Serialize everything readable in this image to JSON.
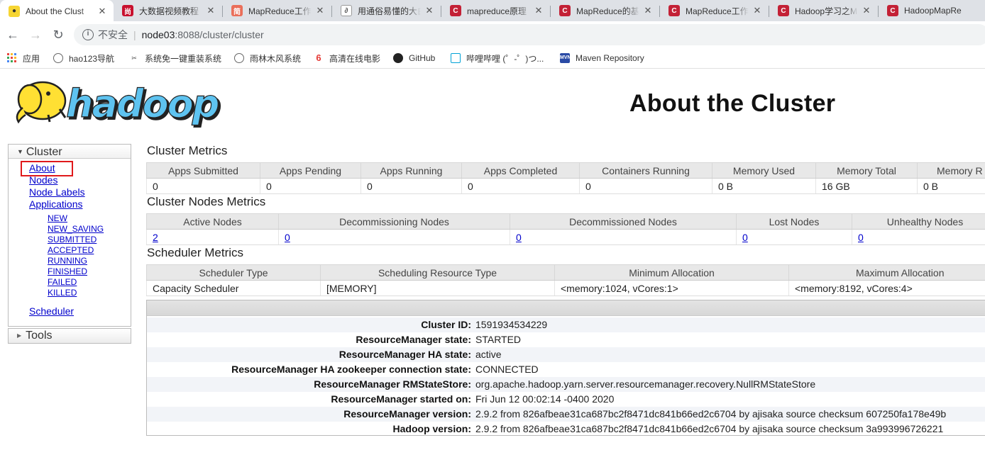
{
  "browser": {
    "tabs": [
      {
        "title": "About the Clust",
        "icon": "hadoop-favicon",
        "color": "#f6d533",
        "active": true
      },
      {
        "title": "大数据视频教程",
        "icon": "shang-favicon",
        "color": "#c8102e"
      },
      {
        "title": "MapReduce工作",
        "icon": "jian-favicon",
        "color": "#ea6f5a"
      },
      {
        "title": "用通俗易懂的大白",
        "icon": "zhihu-like-favicon",
        "color": "#555555"
      },
      {
        "title": "mapreduce原理",
        "icon": "csdn-favicon",
        "color": "#c32136"
      },
      {
        "title": "MapReduce的基",
        "icon": "csdn-favicon",
        "color": "#c32136"
      },
      {
        "title": "MapReduce工作",
        "icon": "csdn-favicon",
        "color": "#c32136"
      },
      {
        "title": "Hadoop学习之M",
        "icon": "csdn-favicon",
        "color": "#c32136"
      },
      {
        "title": "HadoopMapRe",
        "icon": "csdn-favicon",
        "color": "#c32136"
      }
    ],
    "address": {
      "security_label": "不安全",
      "host": "node03",
      "path": ":8088/cluster/cluster"
    },
    "bookmarks": [
      {
        "label": "应用",
        "icon": "apps-grid-icon"
      },
      {
        "label": "hao123导航",
        "icon": "globe-icon"
      },
      {
        "label": "系统免一键重装系统",
        "icon": "tool-icon"
      },
      {
        "label": "雨林木风系统",
        "icon": "globe-icon"
      },
      {
        "label": "高清在线电影",
        "icon": "flame-icon"
      },
      {
        "label": "GitHub",
        "icon": "github-icon"
      },
      {
        "label": "哔哩哔哩 (゜-゜)つ...",
        "icon": "bilibili-icon"
      },
      {
        "label": "Maven Repository",
        "icon": "maven-icon"
      }
    ]
  },
  "page": {
    "title": "About the Cluster",
    "logo_text": "hadoop"
  },
  "sidebar": {
    "cluster_header": "Cluster",
    "links": {
      "about": "About",
      "nodes": "Nodes",
      "node_labels": "Node Labels",
      "applications": "Applications",
      "scheduler": "Scheduler"
    },
    "app_states": [
      "NEW",
      "NEW_SAVING",
      "SUBMITTED",
      "ACCEPTED",
      "RUNNING",
      "FINISHED",
      "FAILED",
      "KILLED"
    ],
    "tools_header": "Tools"
  },
  "cluster_metrics": {
    "title": "Cluster Metrics",
    "headers": [
      "Apps Submitted",
      "Apps Pending",
      "Apps Running",
      "Apps Completed",
      "Containers Running",
      "Memory Used",
      "Memory Total",
      "Memory R"
    ],
    "values": [
      "0",
      "0",
      "0",
      "0",
      "0",
      "0 B",
      "16 GB",
      "0 B"
    ]
  },
  "node_metrics": {
    "title": "Cluster Nodes Metrics",
    "headers": [
      "Active Nodes",
      "Decommissioning Nodes",
      "Decommissioned Nodes",
      "Lost Nodes",
      "Unhealthy Nodes"
    ],
    "values": [
      "2",
      "0",
      "0",
      "0",
      "0"
    ]
  },
  "scheduler_metrics": {
    "title": "Scheduler Metrics",
    "headers": [
      "Scheduler Type",
      "Scheduling Resource Type",
      "Minimum Allocation",
      "Maximum Allocation"
    ],
    "values": [
      "Capacity Scheduler",
      "[MEMORY]",
      "<memory:1024, vCores:1>",
      "<memory:8192, vCores:4>"
    ]
  },
  "cluster_info": [
    {
      "label": "Cluster ID:",
      "value": "1591934534229"
    },
    {
      "label": "ResourceManager state:",
      "value": "STARTED"
    },
    {
      "label": "ResourceManager HA state:",
      "value": "active"
    },
    {
      "label": "ResourceManager HA zookeeper connection state:",
      "value": "CONNECTED"
    },
    {
      "label": "ResourceManager RMStateStore:",
      "value": "org.apache.hadoop.yarn.server.resourcemanager.recovery.NullRMStateStore"
    },
    {
      "label": "ResourceManager started on:",
      "value": "Fri Jun 12 00:02:14 -0400 2020"
    },
    {
      "label": "ResourceManager version:",
      "value": "2.9.2 from 826afbeae31ca687bc2f8471dc841b66ed2c6704 by ajisaka source checksum 607250fa178e49b"
    },
    {
      "label": "Hadoop version:",
      "value": "2.9.2 from 826afbeae31ca687bc2f8471dc841b66ed2c6704 by ajisaka source checksum 3a993996726221"
    }
  ]
}
